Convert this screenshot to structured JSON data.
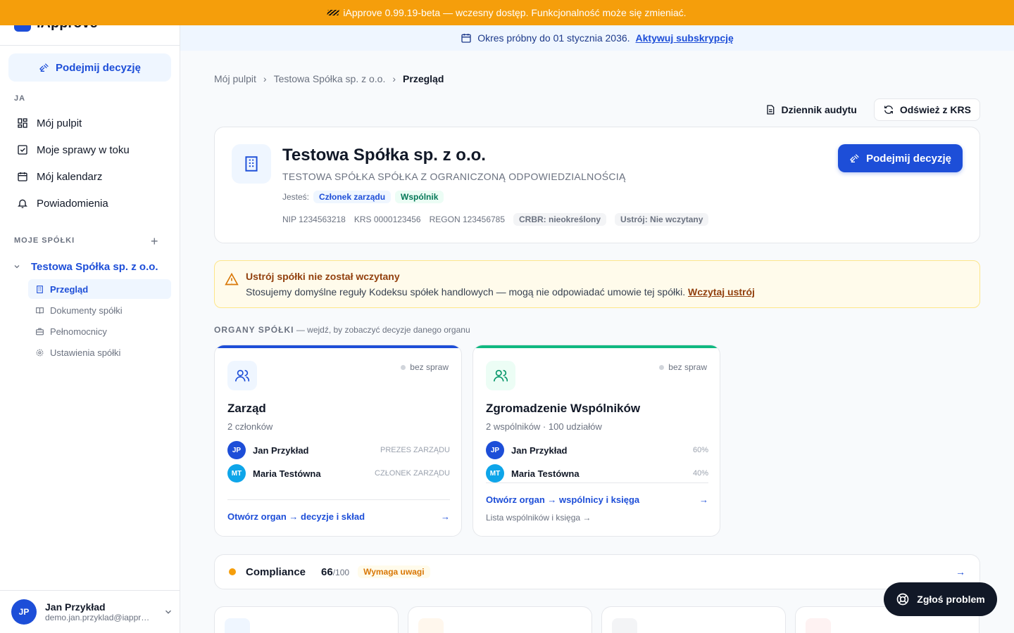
{
  "beta_banner": {
    "text": "iApprove 0.99.19-beta — wczesny dostęp. Funkcjonalność może się zmieniać."
  },
  "brand": {
    "name": "iApprove"
  },
  "sidebar": {
    "decide_label": "Podejmij decyzję",
    "section_me": "JA",
    "nav": [
      {
        "label": "Mój pulpit",
        "icon": "dashboard-icon"
      },
      {
        "label": "Moje sprawy w toku",
        "icon": "checkbox-icon"
      },
      {
        "label": "Mój kalendarz",
        "icon": "calendar-icon"
      },
      {
        "label": "Powiadomienia",
        "icon": "bell-icon"
      }
    ],
    "section_companies": "MOJE SPÓŁKI",
    "company": "Testowa Spółka sp. z o.o.",
    "company_items": [
      {
        "label": "Przegląd",
        "icon": "building-icon"
      },
      {
        "label": "Dokumenty spółki",
        "icon": "book-icon"
      },
      {
        "label": "Pełnomocnicy",
        "icon": "briefcase-icon"
      },
      {
        "label": "Ustawienia spółki",
        "icon": "gear-icon"
      }
    ],
    "user": {
      "initials": "JP",
      "name": "Jan Przykład",
      "email": "demo.jan.przyklad@iapprove.pl"
    }
  },
  "trial": {
    "text": "Okres próbny do 01 stycznia 2036.",
    "link": "Aktywuj subskrypcję"
  },
  "breadcrumb": [
    "Mój pulpit",
    "Testowa Spółka sp. z o.o.",
    "Przegląd"
  ],
  "actions": {
    "audit": "Dziennik audytu",
    "refresh": "Odśwież z KRS"
  },
  "company_header": {
    "title": "Testowa Spółka sp. z o.o.",
    "subtitle": "TESTOWA SPÓŁKA SPÓŁKA Z OGRANICZONĄ ODPOWIEDZIALNOŚCIĄ",
    "roles_label": "Jesteś:",
    "roles": [
      "Członek zarządu",
      "Wspólnik"
    ],
    "nip": "NIP 1234563218",
    "krs": "KRS 0000123456",
    "regon": "REGON 123456785",
    "crbr": "CRBR: nieokreślony",
    "ustroj": "Ustrój: Nie wczytany",
    "decide_label": "Podejmij decyzję"
  },
  "warning": {
    "title": "Ustrój spółki nie został wczytany",
    "text": "Stosujemy domyślne reguły Kodeksu spółek handlowych — mogą nie odpowiadać umowie tej spółki.",
    "link": "Wczytaj ustrój"
  },
  "organs_label": {
    "title": "ORGANY SPÓŁKI",
    "hint": "— wejdź, by zobaczyć decyzje danego organu"
  },
  "organs": [
    {
      "title": "Zarząd",
      "subtitle": "2 członków",
      "status": "bez spraw",
      "color": "#1d4ed8",
      "members": [
        {
          "initials": "JP",
          "name": "Jan Przykład",
          "role": "PREZES ZARZĄDU",
          "color": "#1d4ed8"
        },
        {
          "initials": "MT",
          "name": "Maria Testówna",
          "role": "CZŁONEK ZARZĄDU",
          "color": "#0ea5e9"
        }
      ],
      "link": "Otwórz organ → decyzje i skład"
    },
    {
      "title": "Zgromadzenie Wspólników",
      "subtitle": "2 wspólników · 100 udziałów",
      "status": "bez spraw",
      "color": "#10b981",
      "members": [
        {
          "initials": "JP",
          "name": "Jan Przykład",
          "role": "60%",
          "color": "#1d4ed8"
        },
        {
          "initials": "MT",
          "name": "Maria Testówna",
          "role": "40%",
          "color": "#0ea5e9"
        }
      ],
      "link": "Otwórz organ → wspólnicy i księga",
      "sublink": "Lista wspólników i księga →"
    }
  ],
  "compliance": {
    "label": "Compliance",
    "score": "66",
    "max": "/100",
    "badge": "Wymaga uwagi"
  },
  "report": {
    "label": "Zgłoś problem"
  }
}
